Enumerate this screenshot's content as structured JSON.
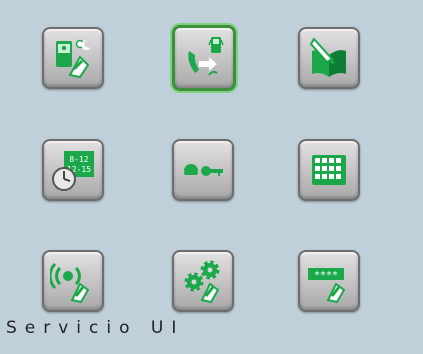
{
  "title": "Servicio UI",
  "tiles": [
    {
      "name": "intercom-day-night-icon",
      "selected": false
    },
    {
      "name": "call-forward-icon",
      "selected": true
    },
    {
      "name": "agenda-book-icon",
      "selected": false
    },
    {
      "name": "time-schedule-icon",
      "selected": false
    },
    {
      "name": "key-access-icon",
      "selected": false
    },
    {
      "name": "keypad-icon",
      "selected": false
    },
    {
      "name": "alarm-signal-icon",
      "selected": false
    },
    {
      "name": "settings-gear-icon",
      "selected": false
    },
    {
      "name": "password-code-icon",
      "selected": false
    }
  ],
  "schedule_text": {
    "line1": "8-12",
    "line2": "12-15"
  },
  "password_text": "****",
  "colors": {
    "accent": "#1aa84a",
    "selected_border": "#3c8f3c",
    "background": "#c0d0da"
  }
}
